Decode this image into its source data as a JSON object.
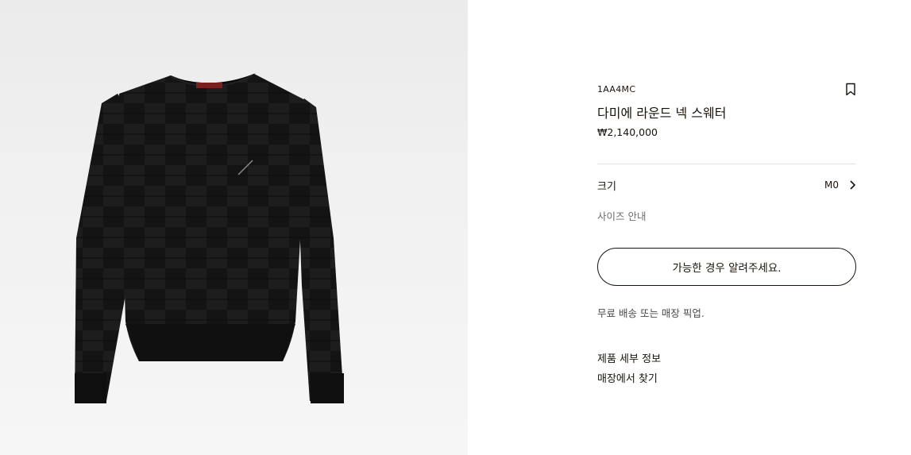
{
  "product_image": {
    "label_text": "LOUIS VUITTON",
    "background": "#efefef",
    "garment_color": "#141414",
    "label_color": "#7a1f1f"
  },
  "product": {
    "sku": "1AA4MC",
    "name": "다미에 라운드 넥 스웨터",
    "price": "₩2,140,000"
  },
  "size": {
    "label": "크기",
    "value": "M0",
    "guide_label": "사이즈 안내"
  },
  "actions": {
    "notify_label": "가능한 경우 알려주세요.",
    "delivery_text": "무료 배송 또는 매장 픽업.",
    "details_link": "제품 세부 정보",
    "stores_link": "매장에서 찾기"
  },
  "icons": {
    "bookmark": "bookmark-icon",
    "chevron": "chevron-right-icon"
  }
}
